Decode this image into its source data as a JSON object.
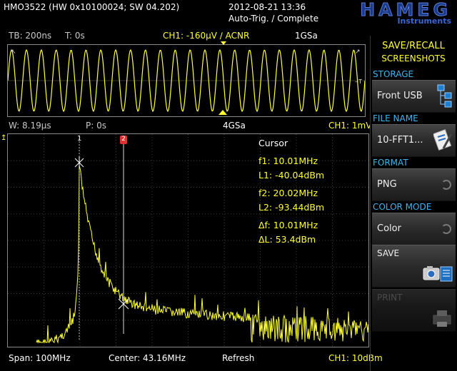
{
  "header": {
    "device": "HMO3522 (HW 0x10100024; SW 04.202)",
    "datetime": "2012-08-21 13:36",
    "trigger_status": "Auto-Trig. / Complete",
    "brand": "HAMEG",
    "brand_sub": "Instruments"
  },
  "top_status": {
    "timebase": "TB: 200ns",
    "time_offset": "T: 0s",
    "channel": "CH1: -160µV ∕ ACNR",
    "samplerate": "1GSa"
  },
  "zoom_status": {
    "window": "W: 8.19µs",
    "position": "P: 0s",
    "samplerate": "4GSa",
    "channel": "CH1: 1mV"
  },
  "waveform": {
    "cycles": 24,
    "color": "#ffff33"
  },
  "spectrum": {
    "cursor_title": "Cursor",
    "f1": "f1: 10.01MHz",
    "l1": "L1: -40.04dBm",
    "f2": "f2: 20.02MHz",
    "l2": "L2: -93.44dBm",
    "df": "Δf: 10.01MHz",
    "dl": "ΔL: 53.4dBm",
    "cursor1_label": "1",
    "cursor2_label": "2"
  },
  "bottom_status": {
    "span": "Span: 100MHz",
    "center": "Center: 43.16MHz",
    "mode": "Refresh",
    "channel": "CH1: 10dBm"
  },
  "menu": {
    "title_line1": "SAVE/RECALL",
    "title_line2": "SCREENSHOTS",
    "storage_label": "STORAGE",
    "storage_value": "Front USB",
    "filename_label": "FILE NAME",
    "filename_value": "10-FFT1...",
    "format_label": "FORMAT",
    "format_value": "PNG",
    "colormode_label": "COLOR MODE",
    "colormode_value": "Color",
    "save_label": "SAVE",
    "print_label": "PRINT"
  },
  "colors": {
    "trace": "#ffff33",
    "menu_section": "#3cb7f0",
    "cursor2": "#e03030",
    "grid": "#5a5a5a"
  }
}
